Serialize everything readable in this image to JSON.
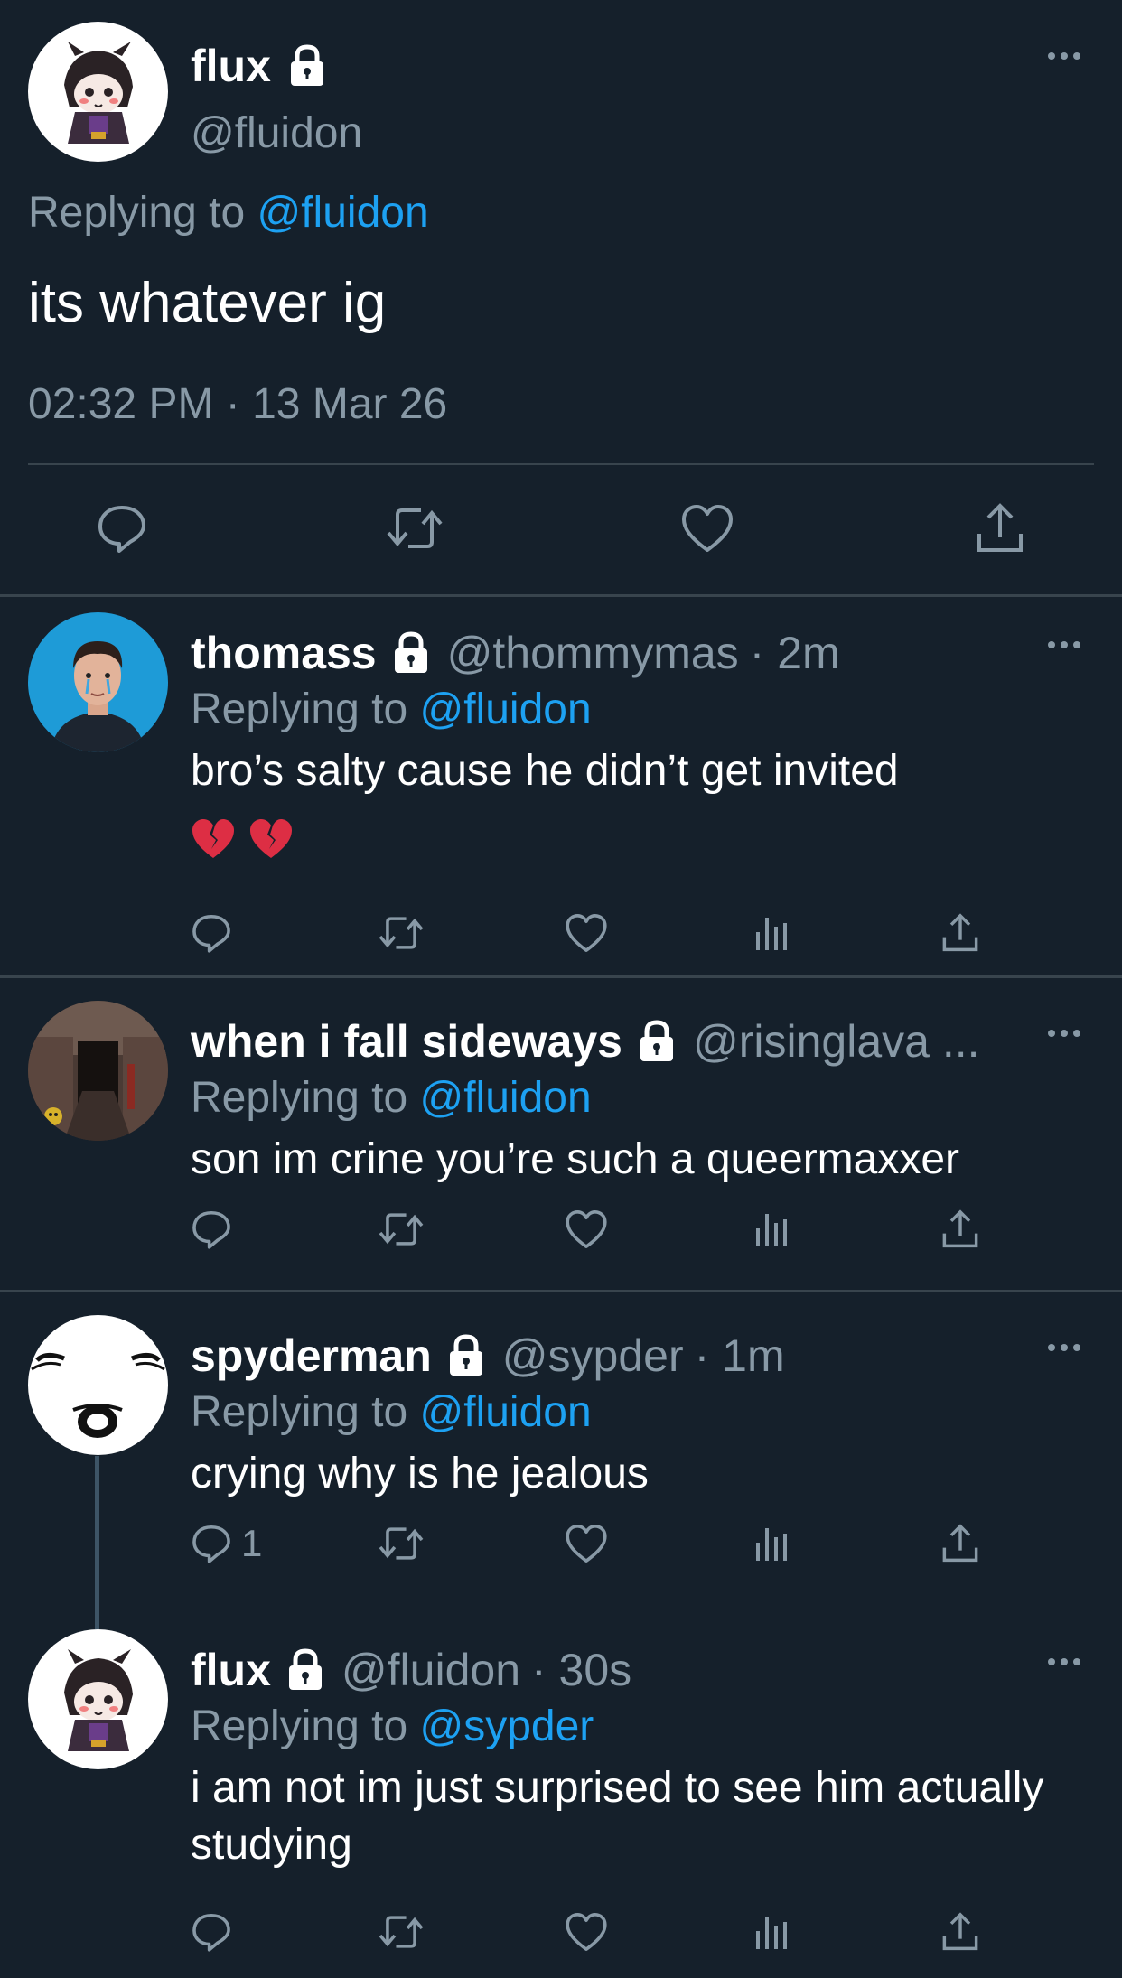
{
  "main_tweet": {
    "display_name": "flux",
    "handle": "@fluidon",
    "replying_prefix": "Replying to",
    "replying_to": "@fluidon",
    "text": "its whatever ig",
    "timestamp": "02:32 PM · 13 Mar 26"
  },
  "replies": [
    {
      "display_name": "thomass",
      "handle": "@thommymas",
      "time": "· 2m",
      "replying_prefix": "Replying to",
      "replying_to": "@fluidon",
      "text": "bro’s salty cause he didn’t get invited",
      "emoji": [
        "broken-heart",
        "broken-heart"
      ],
      "reply_count": ""
    },
    {
      "display_name": "when i fall sideways",
      "handle": "@risinglava ...",
      "time": "",
      "replying_prefix": "Replying to",
      "replying_to": "@fluidon",
      "text": "son im crine you’re such a queermaxxer",
      "reply_count": ""
    },
    {
      "display_name": "spyderman",
      "handle": "@sypder",
      "time": "· 1m",
      "replying_prefix": "Replying to",
      "replying_to": "@fluidon",
      "text": "crying why is he jealous",
      "reply_count": "1"
    },
    {
      "display_name": "flux",
      "handle": "@fluidon",
      "time": "· 30s",
      "replying_prefix": "Replying to",
      "replying_to": "@sypder",
      "text": "i am not im just surprised to see him actually studying",
      "reply_count": ""
    }
  ],
  "colors": {
    "background": "#15202b",
    "divider": "#38444d",
    "muted_text": "#8899a6",
    "link": "#1da1f2",
    "primary_text": "#ffffff"
  }
}
